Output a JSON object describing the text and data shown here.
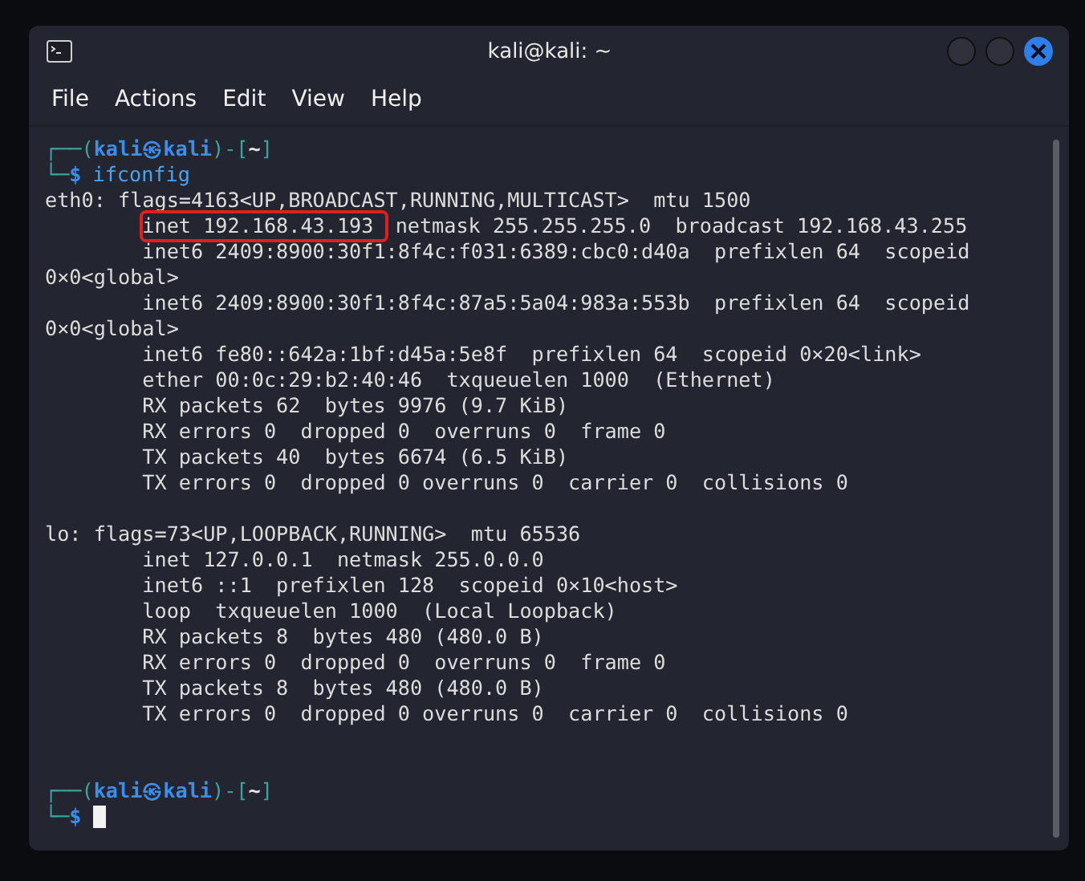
{
  "window": {
    "title": "kali@kali: ~"
  },
  "menu": [
    "File",
    "Actions",
    "Edit",
    "View",
    "Help"
  ],
  "terminal": {
    "lines": [
      {
        "kind": "prompt",
        "parts": [
          {
            "kind": "frame",
            "text": "┌──("
          },
          {
            "kind": "user",
            "text": "kali㉿kali"
          },
          {
            "kind": "frame",
            "text": ")-["
          },
          {
            "kind": "dir",
            "text": "~"
          },
          {
            "kind": "frame",
            "text": "]"
          }
        ]
      },
      {
        "kind": "input",
        "frame": "└─",
        "sign": "$",
        "text": "ifconfig",
        "cursor": false
      },
      {
        "kind": "output",
        "text": "eth0: flags=4163<UP,BROADCAST,RUNNING,MULTICAST>  mtu 1500"
      },
      {
        "kind": "boxed",
        "boxed": "inet 192.168.43.193 ",
        "text": "netmask 255.255.255.0  broadcast 192.168.43.255"
      },
      {
        "kind": "output",
        "text": "        inet6 2409:8900:30f1:8f4c:f031:6389:cbc0:d40a  prefixlen 64  scopeid"
      },
      {
        "kind": "output",
        "text": "0×0<global>"
      },
      {
        "kind": "output",
        "text": "        inet6 2409:8900:30f1:8f4c:87a5:5a04:983a:553b  prefixlen 64  scopeid"
      },
      {
        "kind": "output",
        "text": "0×0<global>"
      },
      {
        "kind": "output",
        "text": "        inet6 fe80::642a:1bf:d45a:5e8f  prefixlen 64  scopeid 0×20<link>"
      },
      {
        "kind": "output",
        "text": "        ether 00:0c:29:b2:40:46  txqueuelen 1000  (Ethernet)"
      },
      {
        "kind": "output",
        "text": "        RX packets 62  bytes 9976 (9.7 KiB)"
      },
      {
        "kind": "output",
        "text": "        RX errors 0  dropped 0  overruns 0  frame 0"
      },
      {
        "kind": "output",
        "text": "        TX packets 40  bytes 6674 (6.5 KiB)"
      },
      {
        "kind": "output",
        "text": "        TX errors 0  dropped 0 overruns 0  carrier 0  collisions 0"
      },
      {
        "kind": "blank"
      },
      {
        "kind": "output",
        "text": "lo: flags=73<UP,LOOPBACK,RUNNING>  mtu 65536"
      },
      {
        "kind": "output",
        "text": "        inet 127.0.0.1  netmask 255.0.0.0"
      },
      {
        "kind": "output",
        "text": "        inet6 ::1  prefixlen 128  scopeid 0×10<host>"
      },
      {
        "kind": "output",
        "text": "        loop  txqueuelen 1000  (Local Loopback)"
      },
      {
        "kind": "output",
        "text": "        RX packets 8  bytes 480 (480.0 B)"
      },
      {
        "kind": "output",
        "text": "        RX errors 0  dropped 0  overruns 0  frame 0"
      },
      {
        "kind": "output",
        "text": "        TX packets 8  bytes 480 (480.0 B)"
      },
      {
        "kind": "output",
        "text": "        TX errors 0  dropped 0 overruns 0  carrier 0  collisions 0"
      },
      {
        "kind": "blank"
      },
      {
        "kind": "blank"
      },
      {
        "kind": "prompt",
        "parts": [
          {
            "kind": "frame",
            "text": "┌──("
          },
          {
            "kind": "user",
            "text": "kali㉿kali"
          },
          {
            "kind": "frame",
            "text": ")-["
          },
          {
            "kind": "dir",
            "text": "~"
          },
          {
            "kind": "frame",
            "text": "]"
          }
        ]
      },
      {
        "kind": "input",
        "frame": "└─",
        "sign": "$",
        "cursor": true
      }
    ]
  }
}
